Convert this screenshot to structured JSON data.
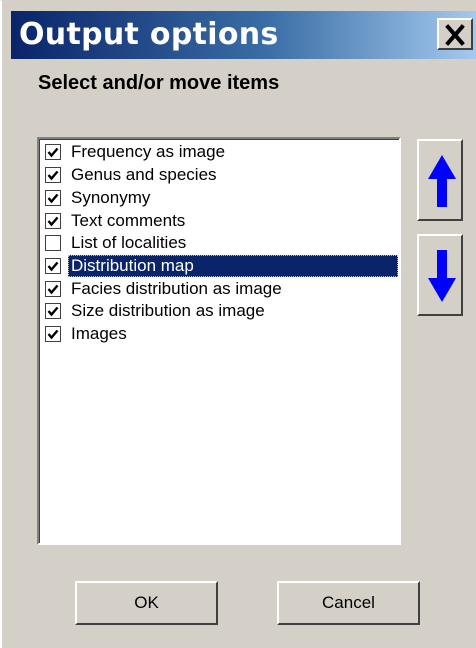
{
  "window": {
    "title": "Output options",
    "close_label": "X"
  },
  "subtitle": "Select and/or move items",
  "items": [
    {
      "label": "Frequency as image",
      "checked": true,
      "selected": false
    },
    {
      "label": "Genus and species",
      "checked": true,
      "selected": false
    },
    {
      "label": "Synonymy",
      "checked": true,
      "selected": false
    },
    {
      "label": "Text comments",
      "checked": true,
      "selected": false
    },
    {
      "label": "List of localities",
      "checked": false,
      "selected": false
    },
    {
      "label": "Distribution map",
      "checked": true,
      "selected": true
    },
    {
      "label": "Facies distribution as image",
      "checked": true,
      "selected": false
    },
    {
      "label": "Size distribution as image",
      "checked": true,
      "selected": false
    },
    {
      "label": "Images",
      "checked": true,
      "selected": false
    }
  ],
  "buttons": {
    "ok": "OK",
    "cancel": "Cancel"
  },
  "icons": {
    "move_up": "arrow-up-icon",
    "move_down": "arrow-down-icon",
    "close": "close-icon",
    "check": "checkmark-icon"
  },
  "colors": {
    "titlebar_start": "#0a246a",
    "titlebar_end": "#a6caf0",
    "selection": "#0a246a",
    "arrow": "#0000ff",
    "face": "#d4d0c8"
  }
}
